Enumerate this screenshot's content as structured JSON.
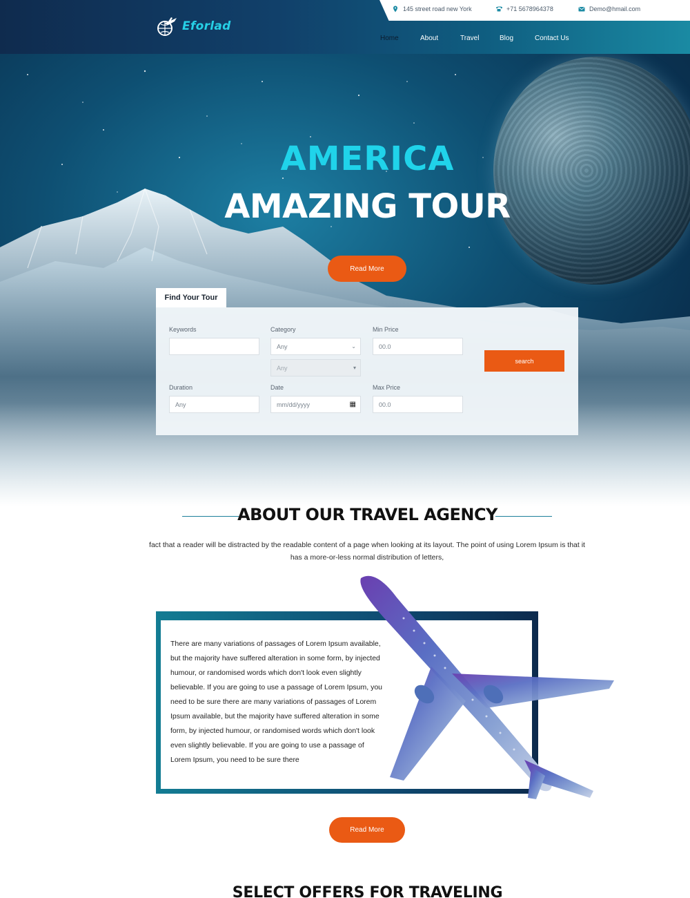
{
  "brand": {
    "name": "Eforlad",
    "accent": "#20d3ea",
    "orange": "#ea5a14"
  },
  "contact": {
    "address": "145 street road new York",
    "phone": "+71 5678964378",
    "email": "Demo@hmail.com"
  },
  "nav": {
    "items": [
      {
        "label": "Home",
        "active": true
      },
      {
        "label": "About"
      },
      {
        "label": "Travel"
      },
      {
        "label": "Blog"
      },
      {
        "label": "Contact Us"
      }
    ]
  },
  "hero": {
    "line1": "AMERICA",
    "line2": "AMAZING TOUR",
    "button": "Read More"
  },
  "search": {
    "tab": "Find Your Tour",
    "keywords_label": "Keywords",
    "keywords_value": "",
    "category_label": "Category",
    "category_value": "Any",
    "subcategory_value": "Any",
    "min_price_label": "Min Price",
    "min_price_value": "00.0",
    "duration_label": "Duration",
    "duration_value": "Any",
    "date_label": "Date",
    "date_placeholder": "mm/dd/yyyy",
    "max_price_label": "Max Price",
    "max_price_value": "00.0",
    "button": "search"
  },
  "about": {
    "title": "ABOUT OUR TRAVEL AGENCY",
    "intro": "fact that a reader will be distracted by the readable content of a page when looking at its layout. The point of using Lorem Ipsum is that it has a more-or-less normal distribution of letters,",
    "body": "There are many variations of passages of Lorem Ipsum available, but the majority have suffered alteration in some form, by injected humour, or randomised words which don't look even slightly believable. If you are going to use a passage of Lorem Ipsum, you need to be sure there are many variations of passages of Lorem Ipsum available, but the majority have suffered alteration in some form, by injected humour, or randomised words which don't look even slightly believable. If you are going to use a passage of Lorem Ipsum, you need to be sure there",
    "button": "Read More"
  },
  "offers": {
    "title": "SELECT OFFERS FOR TRAVELING"
  }
}
